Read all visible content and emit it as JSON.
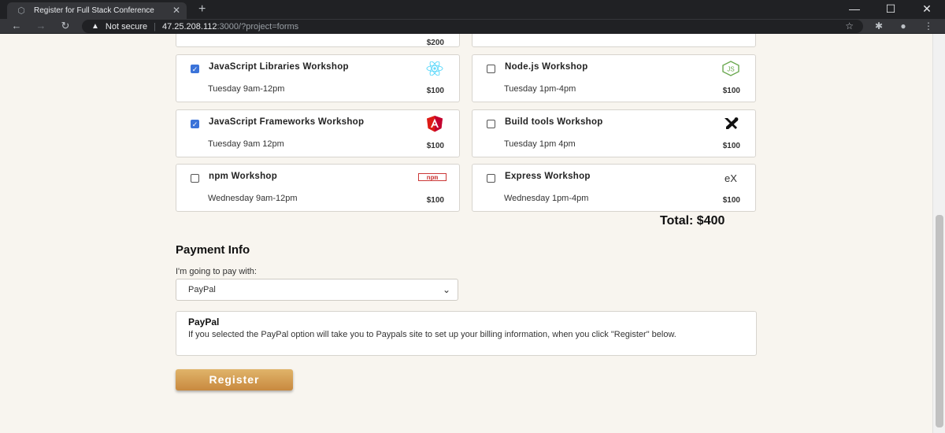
{
  "browser": {
    "tab_title": "Register for Full Stack Conference",
    "tab_close": "✕",
    "new_tab": "+",
    "minimize": "—",
    "maximize": "☐",
    "close": "✕",
    "not_secure": "Not secure",
    "url_host": "47.25.208.112",
    "url_path": ":3000/?project=forms"
  },
  "page": {
    "top_price": "$200",
    "workshops": [
      {
        "name": "JavaScript Libraries Workshop",
        "when": "Tuesday 9am-12pm",
        "price": "$100",
        "checked": true,
        "logo": "react-icon"
      },
      {
        "name": "Node.js Workshop",
        "when": "Tuesday 1pm-4pm",
        "price": "$100",
        "checked": false,
        "logo": "nodejs-icon"
      },
      {
        "name": "JavaScript Frameworks Workshop",
        "when": "Tuesday 9am 12pm",
        "price": "$100",
        "checked": true,
        "logo": "angular-icon"
      },
      {
        "name": "Build tools Workshop",
        "when": "Tuesday 1pm 4pm",
        "price": "$100",
        "checked": false,
        "logo": "tools-icon"
      },
      {
        "name": "npm Workshop",
        "when": "Wednesday 9am-12pm",
        "price": "$100",
        "checked": false,
        "logo": "npm-icon"
      },
      {
        "name": "Express Workshop",
        "when": "Wednesday 1pm-4pm",
        "price": "$100",
        "checked": false,
        "logo": "express-icon"
      }
    ],
    "logos": {
      "nodejs": "JS",
      "npm": "npm",
      "express": "eX"
    },
    "total": "Total: $400",
    "payment_title": "Payment Info",
    "payment_label": "I'm going to pay with:",
    "payment_selected": "PayPal",
    "paypal_title": "PayPal",
    "paypal_text": "If you selected the PayPal option will take you to Paypals site to set up your billing information, when you click \"Register\" below.",
    "register_label": "Register"
  },
  "colors": {
    "accent": "#3b73d9",
    "register": "#d4a055",
    "angular": "#dd1b16",
    "npm": "#cb3837",
    "react": "#61dafb",
    "node": "#6aa84f"
  }
}
